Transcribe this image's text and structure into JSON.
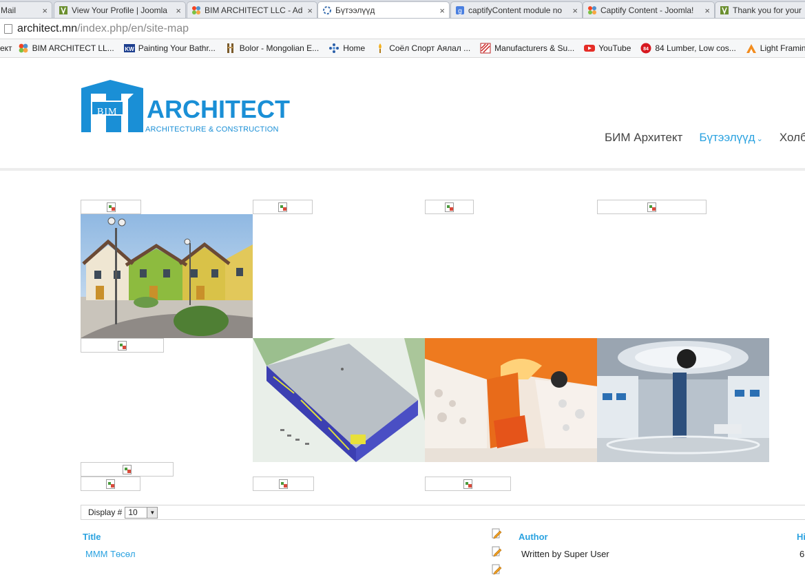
{
  "browser": {
    "tabs": [
      {
        "title": "Mail",
        "icon": "mail-icon"
      },
      {
        "title": "View Your Profile | Joomla",
        "icon": "joomla-forum-icon"
      },
      {
        "title": "BIM ARCHITECT LLC - Ad",
        "icon": "joomla-icon"
      },
      {
        "title": "Бүтээлүүд",
        "icon": "site-icon",
        "active": true
      },
      {
        "title": "captifyContent module no",
        "icon": "google-icon"
      },
      {
        "title": "Captify Content - Joomla!",
        "icon": "joomla-icon"
      },
      {
        "title": "Thank you for your",
        "icon": "joomla-forum-icon"
      }
    ],
    "close_glyph": "×",
    "url_domain": "architect.mn",
    "url_path": "/index.php/en/site-map",
    "bookmarks": [
      {
        "label": "ект",
        "icon": "none"
      },
      {
        "label": "BIM ARCHITECT LL...",
        "icon": "joomla-icon"
      },
      {
        "label": "Painting Your Bathr...",
        "icon": "kw-icon"
      },
      {
        "label": "Bolor - Mongolian E...",
        "icon": "bolor-icon"
      },
      {
        "label": "Home",
        "icon": "dots-icon"
      },
      {
        "label": "Соёл Спорт Аялал ...",
        "icon": "torch-icon"
      },
      {
        "label": "Manufacturers & Su...",
        "icon": "stripes-icon"
      },
      {
        "label": "YouTube",
        "icon": "youtube-icon"
      },
      {
        "label": "84 Lumber, Low cos...",
        "icon": "lumber-icon"
      },
      {
        "label": "Light Framing",
        "icon": "framing-icon"
      }
    ]
  },
  "site": {
    "logo": {
      "mark": "BIM",
      "name": "ARCHITECT",
      "tagline": "ARCHITECTURE & CONSTRUCTION"
    },
    "nav": [
      {
        "label": "БИМ Архитект",
        "active": false
      },
      {
        "label": "Бүтээлүүд",
        "active": true,
        "dropdown": true
      },
      {
        "label": "Холбоо",
        "active": false
      }
    ],
    "chevron": "⌄",
    "display": {
      "label": "Display #",
      "value": "10"
    },
    "table": {
      "headers": {
        "title": "Title",
        "author": "Author",
        "hits": "Hi"
      },
      "rows": [
        {
          "title": "МММ Төсөл",
          "author": "Written by Super User",
          "hits": "6"
        }
      ]
    },
    "colors": {
      "accent": "#2aa2e0",
      "logo": "#1a8fd6"
    }
  }
}
